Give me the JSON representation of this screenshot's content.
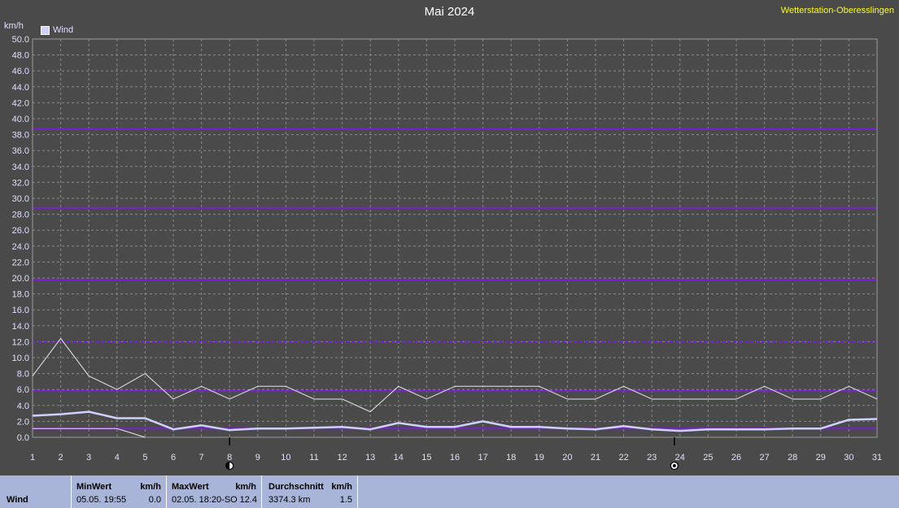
{
  "header": {
    "title": "Mai 2024",
    "station": "Wetterstation-Oberesslingen",
    "unit": "km/h",
    "legend_label": "Wind"
  },
  "chart_data": {
    "type": "line",
    "title": "Mai 2024",
    "ylabel": "km/h",
    "xlabel": "",
    "ylim": [
      0,
      50
    ],
    "y_ticks": [
      "0.0",
      "2.0",
      "4.0",
      "6.0",
      "8.0",
      "10.0",
      "12.0",
      "14.0",
      "16.0",
      "18.0",
      "20.0",
      "22.0",
      "24.0",
      "26.0",
      "28.0",
      "30.0",
      "32.0",
      "34.0",
      "36.0",
      "38.0",
      "40.0",
      "42.0",
      "44.0",
      "46.0",
      "48.0",
      "50.0"
    ],
    "x": [
      1,
      2,
      3,
      4,
      5,
      6,
      7,
      8,
      9,
      10,
      11,
      12,
      13,
      14,
      15,
      16,
      17,
      18,
      19,
      20,
      21,
      22,
      23,
      24,
      25,
      26,
      27,
      28,
      29,
      30,
      31
    ],
    "x_tick_labels": [
      "1",
      "2",
      "3",
      "4",
      "5",
      "6",
      "7",
      "8",
      "9",
      "10",
      "11",
      "12",
      "13",
      "14",
      "15",
      "16",
      "17",
      "18",
      "19",
      "20",
      "21",
      "22",
      "23",
      "24",
      "25",
      "26",
      "27",
      "28",
      "29",
      "30",
      "31"
    ],
    "grid": true,
    "legend": "top-left",
    "series": [
      {
        "name": "Wind",
        "color": "#d0d0ff",
        "values": [
          2.7,
          2.9,
          3.2,
          2.4,
          2.4,
          1.0,
          1.5,
          0.9,
          1.1,
          1.1,
          1.2,
          1.3,
          1.0,
          1.8,
          1.3,
          1.3,
          2.0,
          1.3,
          1.3,
          1.1,
          1.0,
          1.4,
          1.0,
          0.8,
          1.0,
          1.0,
          1.0,
          1.1,
          1.1,
          2.2,
          2.3
        ]
      },
      {
        "color": "#e8e8e8",
        "values": [
          7.7,
          12.4,
          7.7,
          6.0,
          8.0,
          4.8,
          6.4,
          4.8,
          6.4,
          6.4,
          4.8,
          4.8,
          3.2,
          6.4,
          4.8,
          6.4,
          6.4,
          6.4,
          6.4,
          4.8,
          4.8,
          6.4,
          4.8,
          4.8,
          4.8,
          4.8,
          6.4,
          4.8,
          4.8,
          6.4,
          4.8
        ]
      },
      {
        "color": "#e8e8e8",
        "x": [
          1,
          4,
          5
        ],
        "values": [
          1.1,
          1.1,
          0.0
        ]
      }
    ],
    "reference_lines": [
      {
        "value": 1.1,
        "style": "solid"
      },
      {
        "value": 5.8,
        "style": "solid"
      },
      {
        "value": 12.0,
        "style": "dashed"
      },
      {
        "value": 19.8,
        "style": "solid"
      },
      {
        "value": 28.8,
        "style": "solid"
      },
      {
        "value": 38.7,
        "style": "solid"
      }
    ],
    "reference_color": "#7a1fd6",
    "moon_markers": [
      {
        "day": 8,
        "phase": "new"
      },
      {
        "day": 23.8,
        "phase": "full"
      }
    ]
  },
  "stats": {
    "row_label": "Wind",
    "min": {
      "head": "MinWert",
      "unit": "km/h",
      "time": "05.05.  19:55",
      "value": "0.0"
    },
    "max": {
      "head": "MaxWert",
      "unit": "km/h",
      "time": "02.05.  18:20-SO",
      "value": "12.4"
    },
    "avg": {
      "head": "Durchschnitt",
      "unit": "km/h",
      "distance": "3374.3 km",
      "value": "1.5"
    }
  }
}
